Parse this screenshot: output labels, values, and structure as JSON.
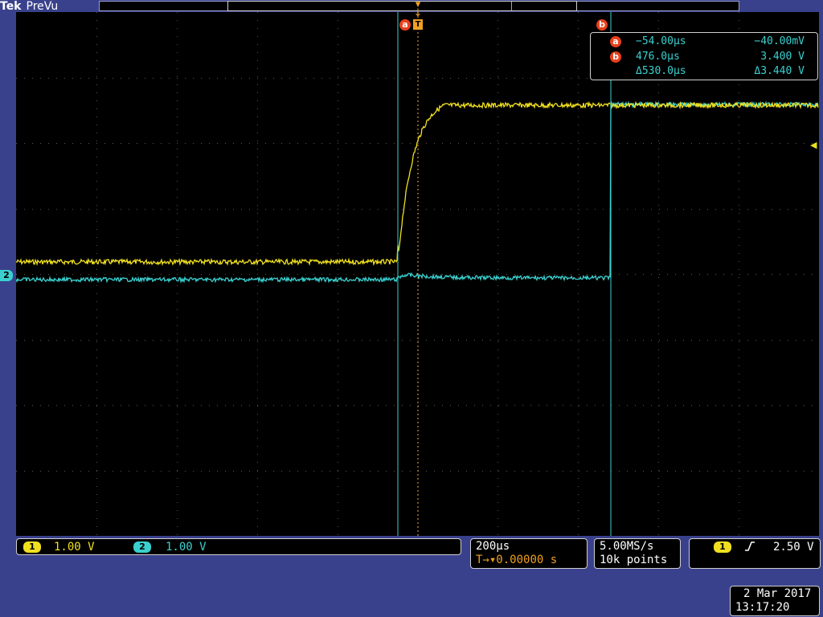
{
  "header": {
    "brand": "Tek",
    "acq_state": "PreVu"
  },
  "markers": {
    "cursor_a_label": "a",
    "cursor_b_label": "b",
    "trigger_label": "T",
    "ch2_label": "2"
  },
  "readout": {
    "a": {
      "label": "a",
      "time": "−54.00µs",
      "value": "−40.00mV"
    },
    "b": {
      "label": "b",
      "time": "476.0µs",
      "value": "3.400 V"
    },
    "delta": {
      "time": "Δ530.0µs",
      "value": "Δ3.440 V"
    }
  },
  "channels": [
    {
      "label": "1",
      "scale": "1.00 V",
      "color": "#f0e020"
    },
    {
      "label": "2",
      "scale": "1.00 V",
      "color": "#3ad0d0"
    }
  ],
  "timebase": {
    "scale": "200µs",
    "delay_prefix": "T→▾",
    "delay": "0.00000 s"
  },
  "acquisition": {
    "sample_rate": "5.00MS/s",
    "record_length": "10k points"
  },
  "trigger": {
    "source": "1",
    "slope_icon": "rising-edge-icon",
    "level": "2.50 V"
  },
  "datetime": {
    "date": "2 Mar  2017",
    "time": "13:17:20"
  },
  "colors": {
    "background": "#3a418c",
    "ch1": "#f0e020",
    "ch2": "#3ad0d0",
    "cursor": "#3ad0d0",
    "marker": "#e8401c",
    "trigger": "#f0a020"
  }
}
